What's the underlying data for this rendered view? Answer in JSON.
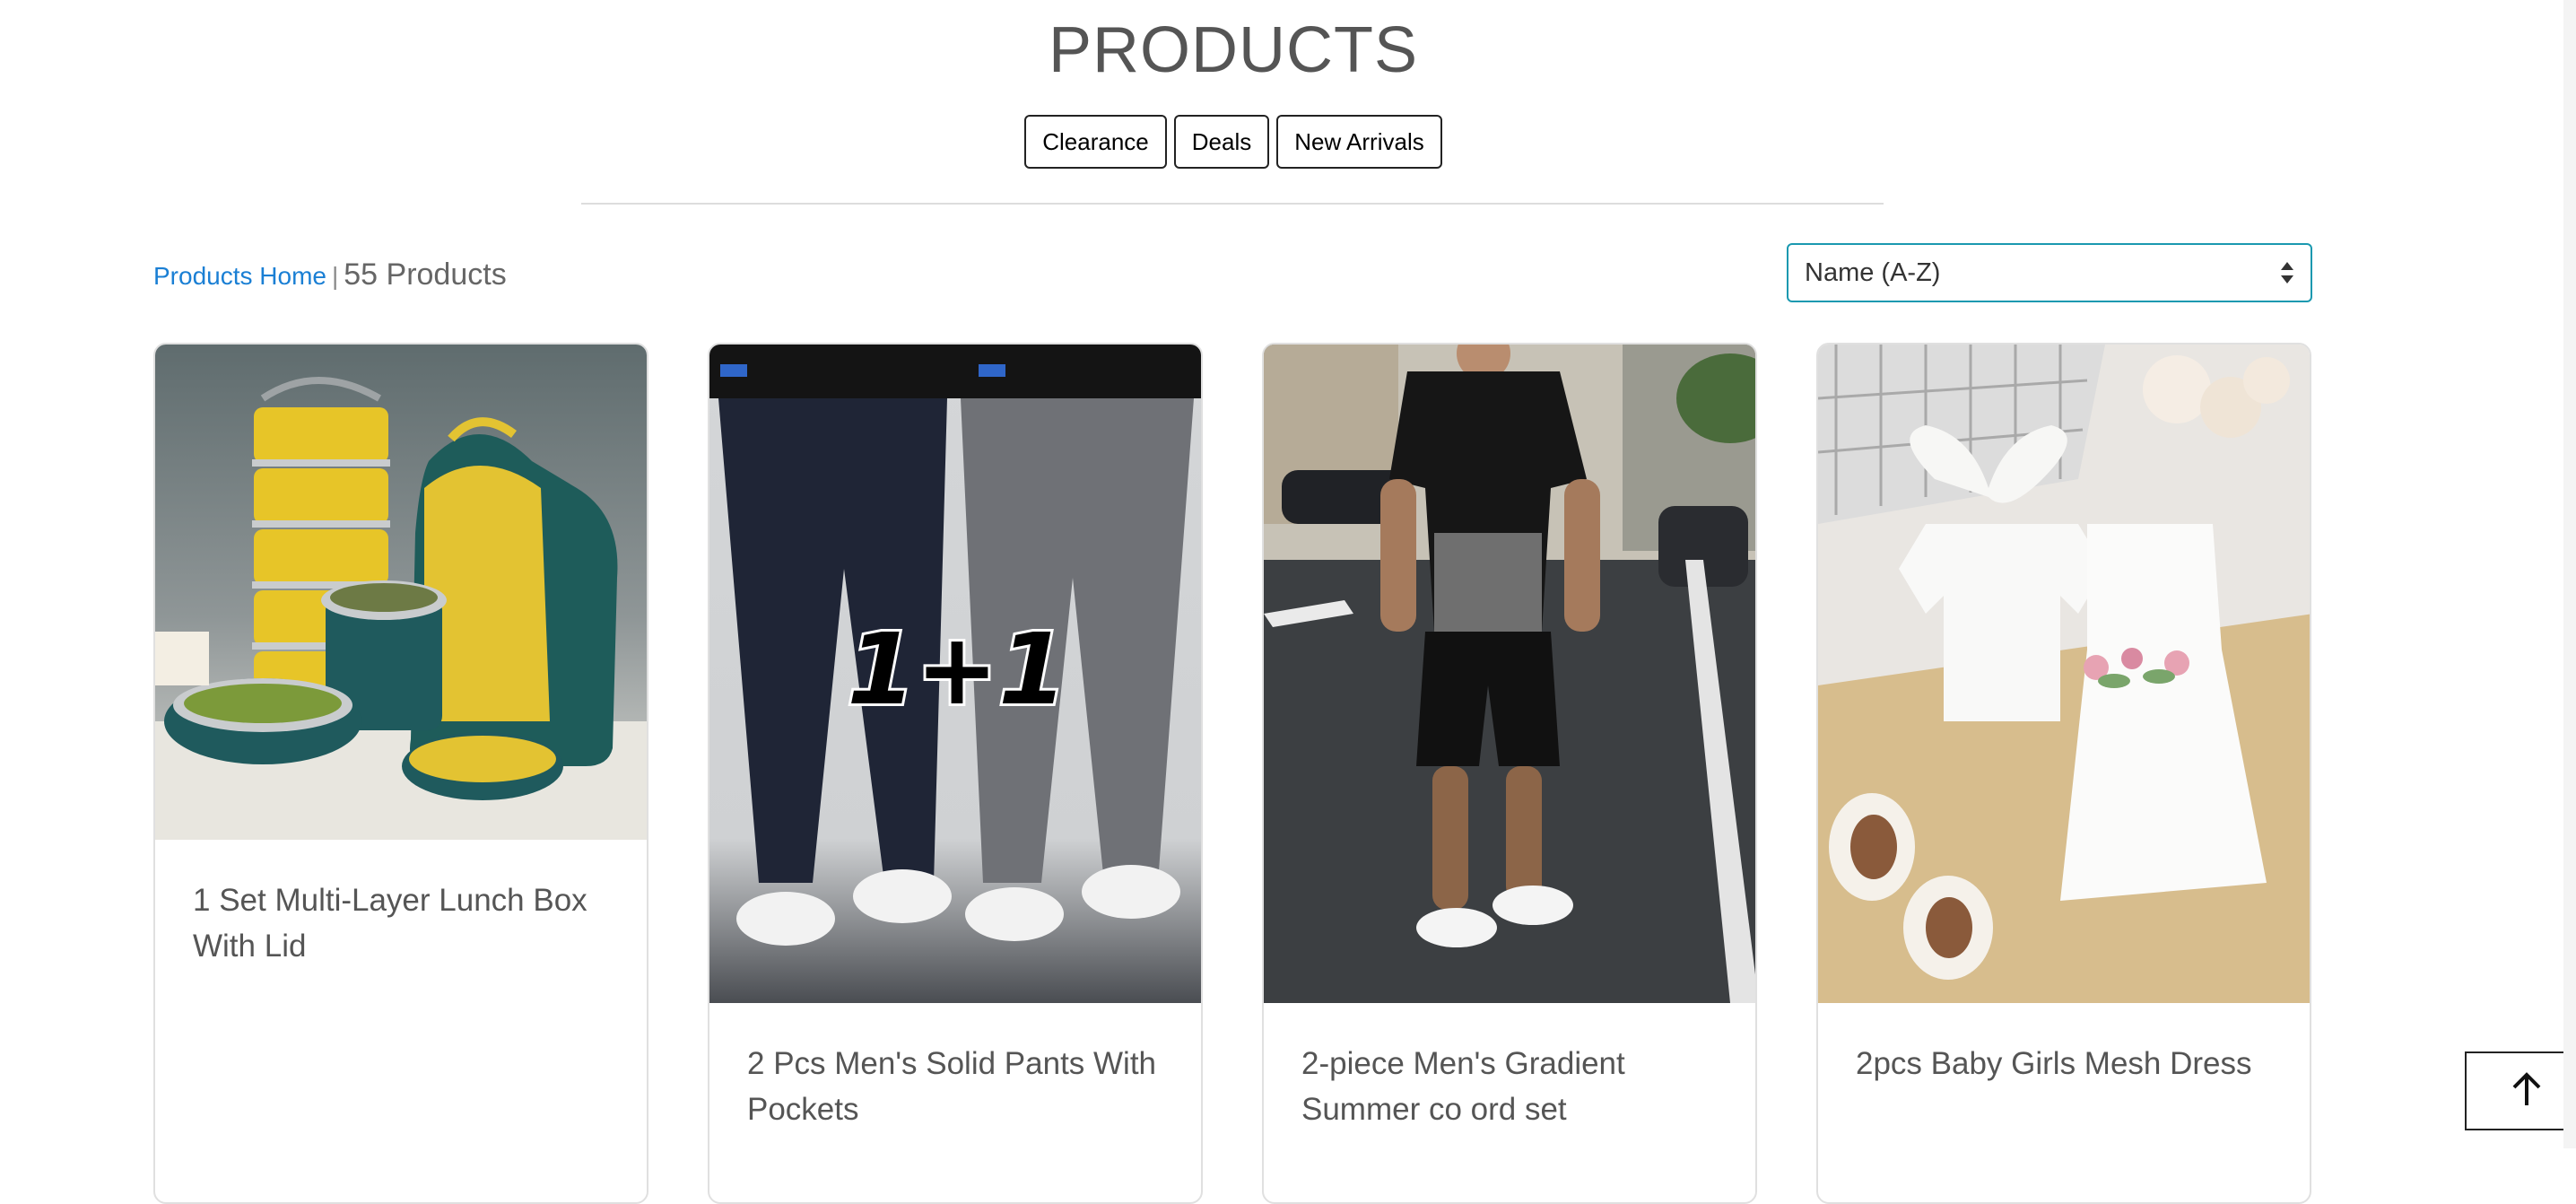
{
  "page": {
    "title": "PRODUCTS"
  },
  "filters": [
    "Clearance",
    "Deals",
    "New Arrivals"
  ],
  "breadcrumb": {
    "home_label": "Products Home",
    "separator": "|",
    "count_label": "55 Products"
  },
  "sort": {
    "selected": "Name (A-Z)"
  },
  "products": [
    {
      "name": "1 Set Multi-Layer Lunch Box With Lid",
      "image": "lunch-box-photo"
    },
    {
      "name": "2 Pcs Men's Solid Pants With Pockets",
      "image": "pants-photo",
      "overlay_text": "1+1"
    },
    {
      "name": "2-piece Men's Gradient Summer co ord set",
      "image": "co-ord-set-photo"
    },
    {
      "name": "2pcs Baby Girls Mesh Dress",
      "image": "baby-dress-photo"
    }
  ],
  "colors": {
    "link": "#1a7fd4",
    "select_border": "#1a99b0",
    "text": "#555555"
  }
}
